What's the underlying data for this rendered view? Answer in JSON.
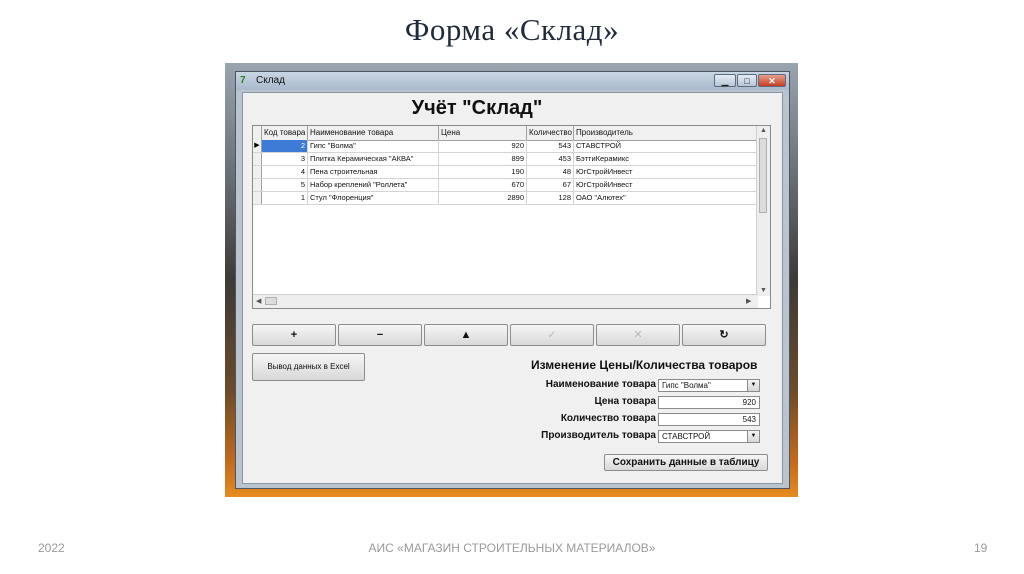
{
  "slide": {
    "title": "Форма «Склад»",
    "footer_left": "2022",
    "footer_center": "АИС «МАГАЗИН СТРОИТЕЛЬНЫХ МАТЕРИАЛОВ»",
    "footer_right": "19"
  },
  "window": {
    "title": "Склад",
    "minimize": "▁",
    "maximize": "□",
    "close": "✕"
  },
  "form": {
    "title": "Учёт \"Склад\""
  },
  "grid": {
    "columns": [
      "Код товара",
      "Наименование товара",
      "Цена",
      "Количество",
      "Производитель"
    ],
    "rows": [
      {
        "code": "2",
        "name": "Гипс \"Волма\"",
        "price": "920",
        "qty": "543",
        "maker": "СТАВСТРОЙ"
      },
      {
        "code": "3",
        "name": "Плитка Керамическая \"АКВА\"",
        "price": "899",
        "qty": "453",
        "maker": "БэттиКерамикс"
      },
      {
        "code": "4",
        "name": "Пена строительная",
        "price": "190",
        "qty": "48",
        "maker": "ЮгСтройИнвест"
      },
      {
        "code": "5",
        "name": "Набор креплений \"Роллета\"",
        "price": "670",
        "qty": "67",
        "maker": "ЮгСтройИнвест"
      },
      {
        "code": "1",
        "name": "Стул \"Флоренция\"",
        "price": "2890",
        "qty": "128",
        "maker": "ОАО \"Алютех\""
      }
    ]
  },
  "navigator": {
    "insert": "+",
    "delete": "−",
    "edit": "▲",
    "post": "✓",
    "cancel": "✕",
    "refresh": "↻"
  },
  "excel_button": "Вывод данных в Excel",
  "edit_panel": {
    "title": "Изменение Цены/Количества товаров",
    "name_label": "Наименование товара",
    "name_value": "Гипс \"Волма\"",
    "price_label": "Цена товара",
    "price_value": "920",
    "qty_label": "Количество товара",
    "qty_value": "543",
    "maker_label": "Производитель товара",
    "maker_value": "СТАВСТРОЙ",
    "save_label": "Сохранить данные в таблицу"
  }
}
